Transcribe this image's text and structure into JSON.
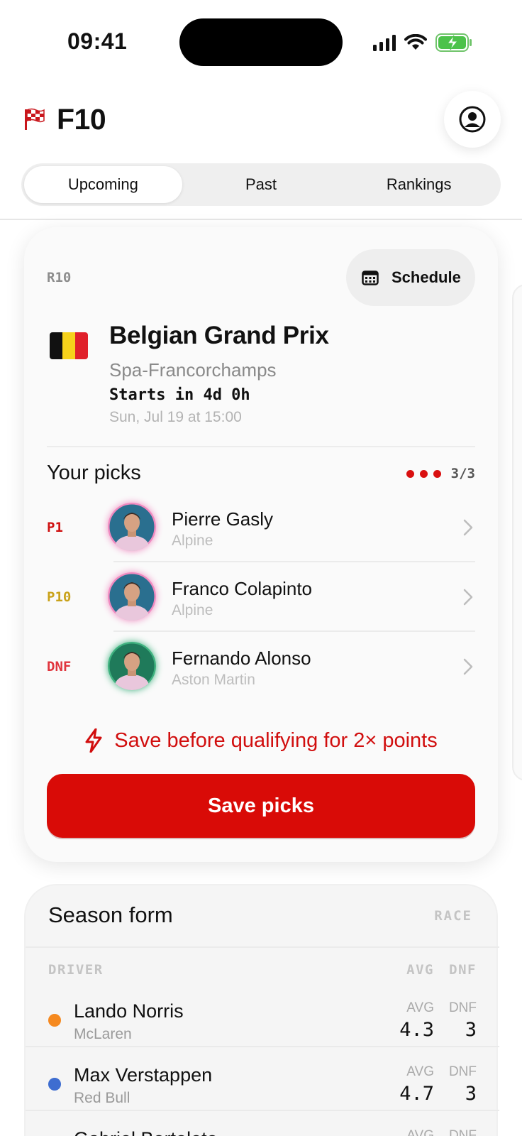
{
  "status_bar": {
    "time": "09:41"
  },
  "header": {
    "app_title": "F10"
  },
  "tabs": [
    {
      "label": "Upcoming",
      "active": true
    },
    {
      "label": "Past",
      "active": false
    },
    {
      "label": "Rankings",
      "active": false
    }
  ],
  "race": {
    "round": "R10",
    "schedule_label": "Schedule",
    "name": "Belgian Grand Prix",
    "circuit": "Spa-Francorchamps",
    "countdown": "Starts in 4d 0h",
    "date": "Sun, Jul 19 at 15:00",
    "flag_colors": [
      "#111111",
      "#f6d21b",
      "#e0202a"
    ]
  },
  "picks": {
    "title": "Your picks",
    "count": "3/3",
    "items": [
      {
        "position": "P1",
        "position_color": "#cf1212",
        "driver": "Pierre Gasly",
        "team": "Alpine",
        "avatar_bg": "#2a6f8f",
        "avatar_ring": "#f08ac0"
      },
      {
        "position": "P10",
        "position_color": "#c9a21a",
        "driver": "Franco Colapinto",
        "team": "Alpine",
        "avatar_bg": "#2a6f8f",
        "avatar_ring": "#f08ac0"
      },
      {
        "position": "DNF",
        "position_color": "#e0353d",
        "driver": "Fernando Alonso",
        "team": "Aston Martin",
        "avatar_bg": "#1f7a5a",
        "avatar_ring": "#3fb27f"
      }
    ],
    "bonus_text": "Save before qualifying for 2× points",
    "save_label": "Save picks"
  },
  "season_form": {
    "title": "Season form",
    "mode": "RACE",
    "columns": {
      "driver": "DRIVER",
      "avg": "AVG",
      "dnf": "DNF"
    },
    "rows": [
      {
        "driver": "Lando Norris",
        "team": "McLaren",
        "team_color": "#f5891f",
        "avg_label": "AVG",
        "avg": "4.3",
        "dnf_label": "DNF",
        "dnf": "3"
      },
      {
        "driver": "Max Verstappen",
        "team": "Red Bull",
        "team_color": "#3e6dd0",
        "avg_label": "AVG",
        "avg": "4.7",
        "dnf_label": "DNF",
        "dnf": "3"
      },
      {
        "driver": "Gabriel Bortoleto",
        "team": "",
        "team_color": "#1ea35a",
        "avg_label": "AVG",
        "avg": "",
        "dnf_label": "DNF",
        "dnf": ""
      }
    ]
  }
}
